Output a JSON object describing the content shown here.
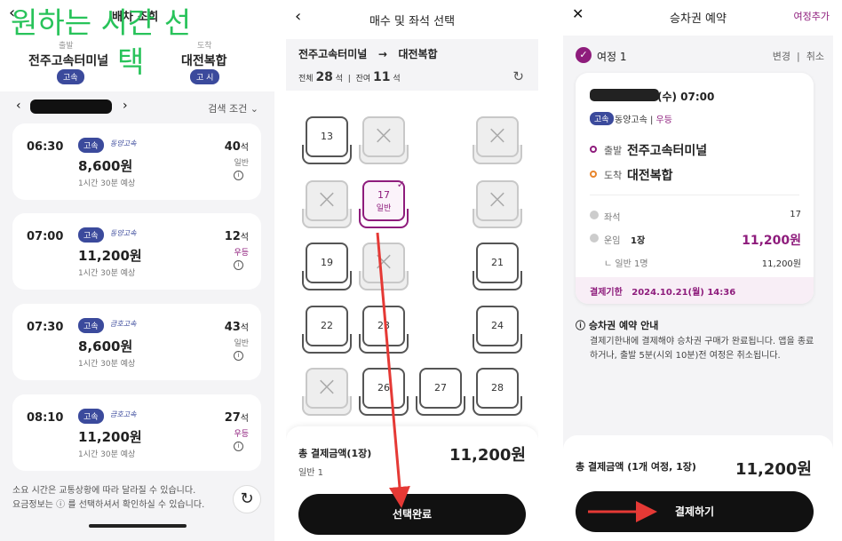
{
  "panel1": {
    "back": "‹",
    "title": "배차 조회",
    "from_label": "출발",
    "to_label": "도착",
    "from_city": "전주고속터미널",
    "to_city": "대전복합",
    "from_pill": "고속",
    "to_pill": "고 시",
    "overlay_line1": "원하는 시간 선",
    "overlay_line2": "택",
    "prev": "‹",
    "next": "›",
    "search_condition": "검색 조건 ⌄",
    "buses": [
      {
        "time": "06:30",
        "badge": "고속",
        "company": "동양고속",
        "price": "8,600원",
        "duration": "1시간 30분 예상",
        "seats": "40",
        "seat_unit": "석",
        "class": "일반"
      },
      {
        "time": "07:00",
        "badge": "고속",
        "company": "동양고속",
        "price": "11,200원",
        "duration": "1시간 30분 예상",
        "seats": "12",
        "seat_unit": "석",
        "class": "우등"
      },
      {
        "time": "07:30",
        "badge": "고속",
        "company": "금호고속",
        "price": "8,600원",
        "duration": "1시간 30분 예상",
        "seats": "43",
        "seat_unit": "석",
        "class": "일반"
      },
      {
        "time": "08:10",
        "badge": "고속",
        "company": "금호고속",
        "price": "11,200원",
        "duration": "1시간 30분 예상",
        "seats": "27",
        "seat_unit": "석",
        "class": "우등"
      }
    ],
    "note1": "소요 시간은 교통상황에 따라 달라질 수 있습니다.",
    "note2": "요금정보는 ⓘ 를 선택하셔서 확인하실 수 있습니다.",
    "refresh": "↻"
  },
  "panel2": {
    "back": "‹",
    "title": "매수 및 좌석 선택",
    "route_from": "전주고속터미널",
    "route_arrow": "→",
    "route_to": "대전복합",
    "total_label": "전체",
    "total": "28",
    "remain_label": "잔여",
    "remain": "11",
    "seat_unit": "석",
    "reload": "↻",
    "seats": {
      "s13": "13",
      "s17": "17",
      "s17_class": "일반",
      "s19": "19",
      "s21": "21",
      "s22": "22",
      "s23": "23",
      "s24": "24",
      "s26": "26",
      "s27": "27",
      "s28": "28",
      "x": "×"
    },
    "total_pay_label": "총 결제금액(1장)",
    "total_pay": "11,200원",
    "breakdown": "일반 1",
    "button": "선택완료"
  },
  "panel3": {
    "close": "✕",
    "title": "승차권 예약",
    "add_trip": "여정추가",
    "trip_label": "여정 1",
    "change": "변경",
    "cancel": "취소",
    "date_suffix": "(수) 07:00",
    "badge": "고속",
    "company": "동양고속",
    "class": "우등",
    "depart_label": "출발",
    "depart": "전주고속터미널",
    "arrive_label": "도착",
    "arrive": "대전복합",
    "seat_label": "좌석",
    "seat": "17",
    "fare_label": "운임",
    "fare_count": "1장",
    "fare": "11,200원",
    "fare_sub_label": "ㄴ 일반 1명",
    "fare_sub": "11,200원",
    "deadline_label": "결제기한",
    "deadline": "2024.10.21(월) 14:36",
    "notice_title": "ⓘ 승차권 예약 안내",
    "notice_body": "결제기한내에 결제해야 승차권 구매가 완료됩니다. 앱을 종료하거나, 출발 5분(시외 10분)전 여정은 취소됩니다.",
    "total_label": "총 결제금액 (1개 여정, 1장)",
    "total": "11,200원",
    "button": "결제하기"
  },
  "colors": {
    "accent": "#8e1c7c",
    "badge": "#3b4a9c",
    "overlay": "#28c35a",
    "arrow": "#e53935"
  }
}
